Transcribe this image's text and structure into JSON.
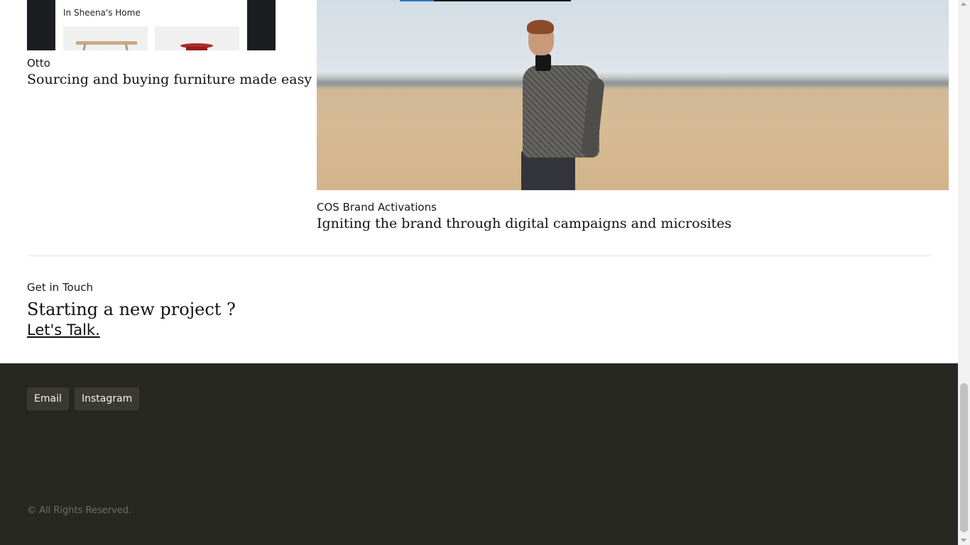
{
  "projects": [
    {
      "phone_title": "In Sheena's Home",
      "client": "Otto",
      "title": "Sourcing and buying furniture made easy"
    },
    {
      "client": "COS Brand Activations",
      "title": "Igniting the brand through digital campaigns and microsites"
    }
  ],
  "contact": {
    "label": "Get in Touch",
    "title": "Starting a new project ?",
    "link": "Let's Talk."
  },
  "footer": {
    "links": [
      "Email",
      "Instagram"
    ],
    "copyright": "© All Rights Reserved."
  },
  "colors": {
    "footer_bg": "#282822",
    "button_bg": "#3a3a33",
    "accent": "#2a74c7"
  }
}
